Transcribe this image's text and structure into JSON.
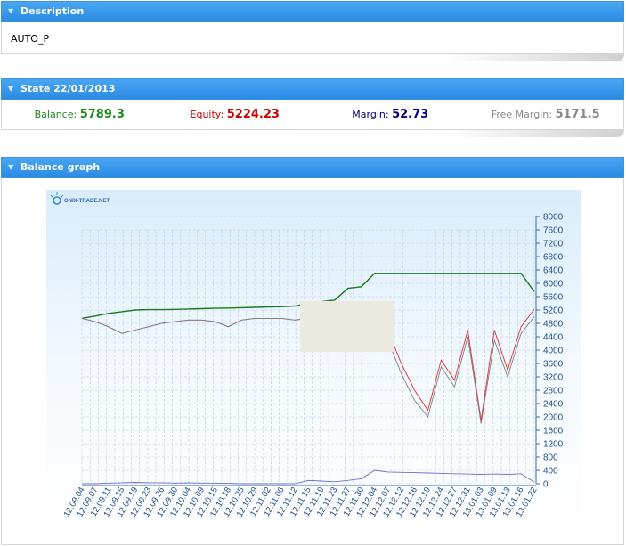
{
  "description": {
    "title": "Description",
    "text": "AUTO_P"
  },
  "state": {
    "title": "State 22/01/2013",
    "balance_label": "Balance:",
    "balance_value": "5789.3",
    "equity_label": "Equity:",
    "equity_value": "5224.23",
    "margin_label": "Margin:",
    "margin_value": "52.73",
    "free_margin_label": "Free Margin:",
    "free_margin_value": "5171.5"
  },
  "graph": {
    "title": "Balance graph",
    "logo_text": "ONIX-TRADE.NET"
  },
  "colors": {
    "header": "#2a8be4",
    "balance": "#1a8a1a",
    "equity": "#cc0000",
    "margin": "#000080",
    "free_margin": "#888888"
  },
  "chart_data": {
    "type": "line",
    "y_ticks": [
      "0",
      "400",
      "800",
      "1200",
      "1600",
      "2000",
      "2400",
      "2800",
      "3200",
      "3600",
      "4000",
      "4400",
      "4800",
      "5200",
      "5600",
      "6000",
      "6400",
      "6800",
      "7200",
      "7600",
      "8000"
    ],
    "ylim": [
      0,
      8000
    ],
    "categories": [
      "12.09.04",
      "12.09.07",
      "12.09.11",
      "12.09.15",
      "12.09.19",
      "12.09.23",
      "12.09.26",
      "12.09.30",
      "12.10.04",
      "12.10.09",
      "12.10.15",
      "12.10.18",
      "12.10.25",
      "12.10.29",
      "12.11.02",
      "12.11.06",
      "12.11.12",
      "12.11.15",
      "12.11.19",
      "12.11.23",
      "12.11.27",
      "12.11.30",
      "12.12.04",
      "12.12.07",
      "12.12.12",
      "12.12.16",
      "12.12.19",
      "12.12.24",
      "12.12.27",
      "12.12.31",
      "13.01.03",
      "13.01.09",
      "13.01.13",
      "13.01.16",
      "13.01.22"
    ],
    "series": [
      {
        "color": "#1a7a1a",
        "values": [
          4950,
          5020,
          5100,
          5150,
          5200,
          5210,
          5210,
          5220,
          5230,
          5240,
          5250,
          5260,
          5270,
          5280,
          5290,
          5300,
          5320,
          5400,
          5450,
          5500,
          5850,
          5900,
          6300,
          6300,
          6300,
          6300,
          6300,
          6300,
          6300,
          6300,
          6300,
          6300,
          6300,
          6300,
          5750
        ]
      },
      {
        "color": "#e03030",
        "values": [
          4950,
          4850,
          4700,
          4500,
          4600,
          4700,
          4800,
          4850,
          4900,
          4900,
          4850,
          4700,
          4900,
          4950,
          4950,
          4950,
          4900,
          4950,
          4950,
          5000,
          4950,
          4900,
          4300,
          4600,
          3600,
          2800,
          2200,
          3700,
          3100,
          4600,
          1900,
          4600,
          3400,
          4700,
          5224
        ]
      },
      {
        "color": "#808080",
        "values": [
          4950,
          4850,
          4700,
          4500,
          4600,
          4700,
          4800,
          4850,
          4900,
          4900,
          4850,
          4700,
          4900,
          4950,
          4950,
          4950,
          4900,
          4950,
          4950,
          5000,
          4950,
          4900,
          4000,
          4300,
          3300,
          2500,
          2000,
          3500,
          2900,
          4400,
          1800,
          4300,
          3200,
          4500,
          5000
        ]
      },
      {
        "color": "#6b6bd0",
        "values": [
          0,
          0,
          20,
          30,
          40,
          30,
          30,
          20,
          30,
          20,
          20,
          10,
          0,
          0,
          0,
          0,
          0,
          100,
          80,
          60,
          100,
          150,
          400,
          350,
          340,
          330,
          320,
          310,
          300,
          290,
          280,
          290,
          280,
          300,
          50
        ]
      }
    ]
  }
}
